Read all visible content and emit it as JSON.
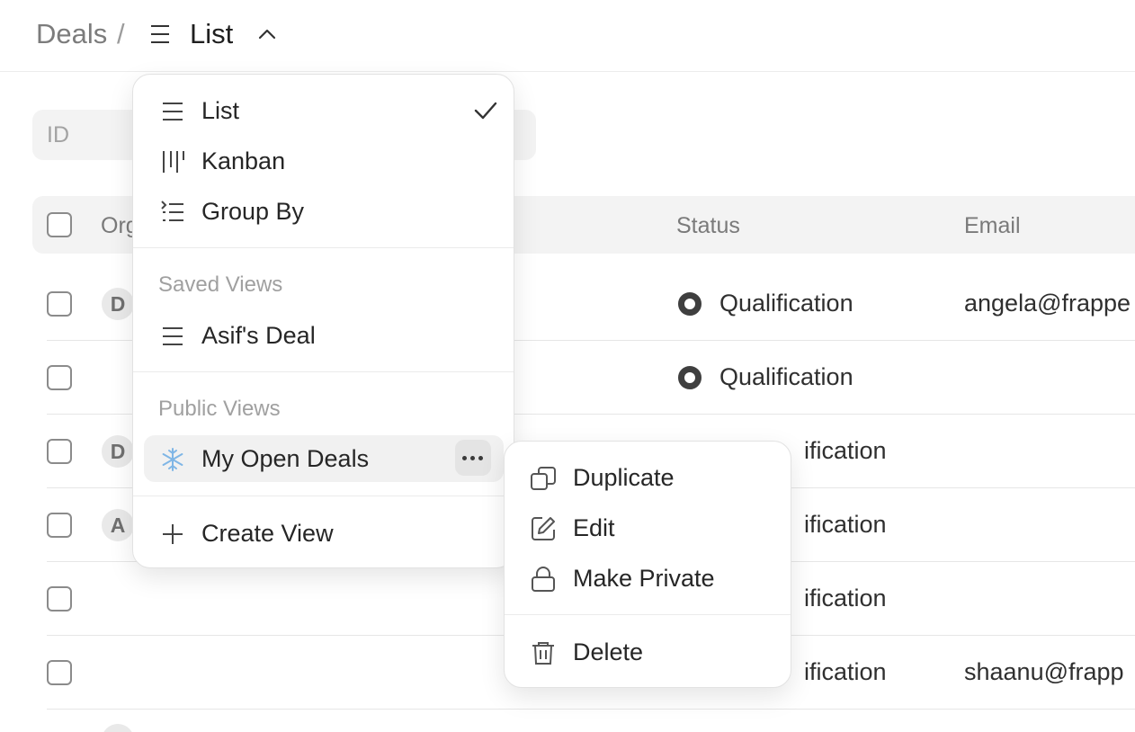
{
  "breadcrumb": {
    "root": "Deals",
    "separator": "/",
    "current_view": "List"
  },
  "filter": {
    "placeholder": "ID"
  },
  "table": {
    "columns": {
      "organization": "Org",
      "status": "Status",
      "email": "Email"
    },
    "rows": [
      {
        "avatar": "D",
        "status": "Qualification",
        "email": "angela@frappe"
      },
      {
        "avatar": "",
        "status": "Qualification",
        "email": ""
      },
      {
        "avatar": "D",
        "status": "ification",
        "email": ""
      },
      {
        "avatar": "A",
        "status": "ification",
        "email": ""
      },
      {
        "avatar": "",
        "status": "ification",
        "email": ""
      },
      {
        "avatar": "",
        "status": "ification",
        "email": "shaanu@frapp"
      }
    ]
  },
  "view_menu": {
    "layouts": [
      {
        "label": "List",
        "icon": "list-icon",
        "selected": true
      },
      {
        "label": "Kanban",
        "icon": "kanban-icon",
        "selected": false
      },
      {
        "label": "Group By",
        "icon": "group-by-icon",
        "selected": false
      }
    ],
    "saved_views_heading": "Saved Views",
    "saved_views": [
      {
        "label": "Asif's Deal",
        "icon": "list-icon"
      }
    ],
    "public_views_heading": "Public Views",
    "public_views": [
      {
        "label": "My Open Deals",
        "icon": "snowflake-icon"
      }
    ],
    "create_view_label": "Create View"
  },
  "context_menu": {
    "items": [
      {
        "label": "Duplicate",
        "icon": "duplicate-icon"
      },
      {
        "label": "Edit",
        "icon": "edit-icon"
      },
      {
        "label": "Make Private",
        "icon": "lock-icon"
      },
      {
        "label": "Delete",
        "icon": "trash-icon"
      }
    ]
  },
  "colors": {
    "header_bg": "#f3f3f3",
    "status_dot": "#3f3f3f",
    "hover": "#f1f1f1",
    "border": "#e6e6e6"
  }
}
